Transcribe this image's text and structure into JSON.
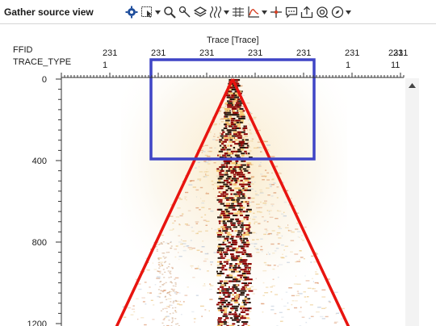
{
  "window": {
    "title": "Gather source view"
  },
  "toolbar": {
    "icons": [
      "gear-icon",
      "select-region-icon",
      "zoom-icon",
      "pointer-icon",
      "layers-icon",
      "wiggle-icon",
      "grid-icon",
      "spectrum-icon",
      "crosshair-icon",
      "comment-icon",
      "export-icon",
      "camera-icon",
      "compass-icon"
    ]
  },
  "header": {
    "ffid_label": "FFID",
    "trace_type_label": "TRACE_TYPE",
    "axis_title": "Trace [Trace]",
    "ffid_values": [
      "231",
      "231",
      "231",
      "231",
      "231",
      "231",
      "231"
    ],
    "trace_type_values": [
      "1",
      "",
      "",
      "",
      "",
      "1",
      "11"
    ],
    "ffid_extra": "231"
  },
  "chart_data": {
    "type": "heatmap",
    "title": "",
    "xlabel": "Trace [Trace]",
    "ylabel": "",
    "y_ticks": [
      "0",
      "400",
      "800",
      "1200"
    ],
    "ylim": [
      0,
      1200
    ],
    "grid": false,
    "colors": {
      "positive": "#8b0000",
      "negative": "#2a1a10",
      "mid": "#f6c56a",
      "accent_box": "#3f45c6",
      "mute_lines": "#e8140f"
    }
  }
}
